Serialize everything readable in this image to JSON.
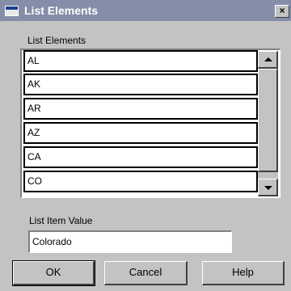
{
  "window": {
    "title": "List Elements",
    "close_glyph": "×"
  },
  "list": {
    "label": "List Elements",
    "items": [
      "AL",
      "AK",
      "AR",
      "AZ",
      "CA",
      "CO"
    ],
    "selected_index": 5
  },
  "value_field": {
    "label": "List Item Value",
    "value": "Colorado"
  },
  "buttons": {
    "ok": "OK",
    "cancel": "Cancel",
    "help": "Help"
  },
  "icons": {
    "system": "window-icon",
    "close": "close-icon",
    "scroll_up": "up-arrow-icon",
    "scroll_down": "down-arrow-icon"
  }
}
